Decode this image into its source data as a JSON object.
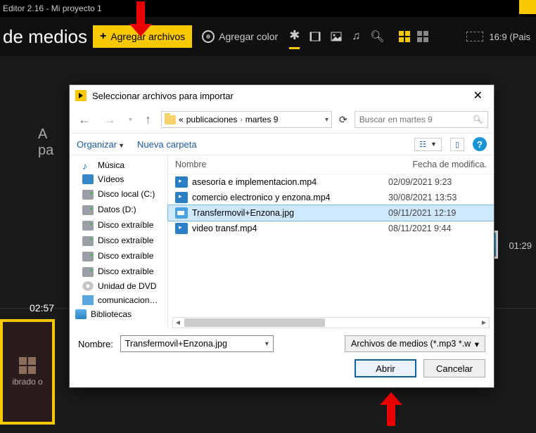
{
  "titlebar": {
    "text": "Editor 2.16  -  Mi proyecto 1"
  },
  "header": {
    "title": "de medios",
    "add_files": "Agregar archivos",
    "add_color": "Agregar color",
    "aspect": "16:9 (Pais"
  },
  "bg": {
    "line1": "A",
    "line2": "pa",
    "drop_label": "ibrado o",
    "time_right": "01:29",
    "time_left": "02:57"
  },
  "dialog": {
    "title": "Seleccionar archivos para importar",
    "breadcrumb_prefix": "«",
    "breadcrumb1": "publicaciones",
    "breadcrumb2": "martes 9",
    "search_placeholder": "Buscar en martes 9",
    "organize": "Organizar",
    "new_folder": "Nueva carpeta",
    "col_name": "Nombre",
    "col_date": "Fecha de modifica.",
    "tree": {
      "music": "Música",
      "videos": "Vídeos",
      "disk_c": "Disco local (C:)",
      "data_d": "Datos (D:)",
      "ext1": "Disco extraíble",
      "ext2": "Disco extraíble",
      "ext3": "Disco extraíble",
      "ext4": "Disco extraíble",
      "dvd": "Unidad de DVD",
      "comm": "comunicacion…",
      "libs": "Bibliotecas"
    },
    "files": [
      {
        "name": "asesoría e implementacion.mp4",
        "date": "02/09/2021 9:23",
        "type": "mp4"
      },
      {
        "name": "comercio electronico y enzona.mp4",
        "date": "30/08/2021 13:53",
        "type": "mp4"
      },
      {
        "name": "Transfermovil+Enzona.jpg",
        "date": "09/11/2021 12:19",
        "type": "jpg",
        "selected": true
      },
      {
        "name": "video transf.mp4",
        "date": "08/11/2021 9:44",
        "type": "mp4"
      }
    ],
    "name_label": "Nombre:",
    "name_value": "Transfermovil+Enzona.jpg",
    "filter": "Archivos de medios (*.mp3 *.w",
    "open": "Abrir",
    "cancel": "Cancelar"
  }
}
